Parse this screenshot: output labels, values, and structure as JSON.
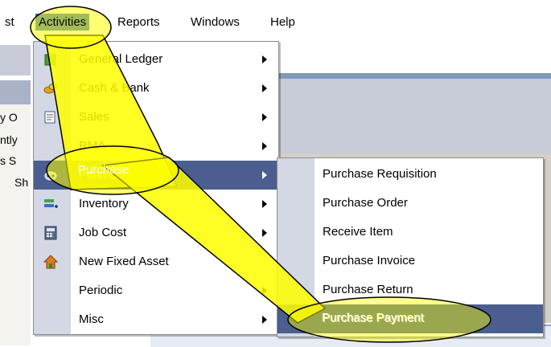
{
  "menubar": {
    "partial_left": "st",
    "activities": "Activities",
    "reports": "Reports",
    "windows": "Windows",
    "help": "Help"
  },
  "background_fragments": [
    "y O",
    "ntly",
    "s S",
    "Sh"
  ],
  "activities_menu": {
    "items": [
      {
        "label": "General Ledger",
        "icon": "ledger-book-icon",
        "submenu": true
      },
      {
        "label": "Cash & Bank",
        "icon": "coins-icon",
        "submenu": true
      },
      {
        "label": "Sales",
        "icon": "sales-invoice-icon",
        "submenu": true
      },
      {
        "label": "RMA",
        "icon": "",
        "submenu": true
      },
      {
        "label": "Purchase",
        "icon": "purchase-cart-icon",
        "submenu": true,
        "highlighted": true
      },
      {
        "label": "Inventory",
        "icon": "inventory-boxes-icon",
        "submenu": true
      },
      {
        "label": "Job Cost",
        "icon": "job-cost-calculator-icon",
        "submenu": true
      },
      {
        "label": "New Fixed Asset",
        "icon": "house-icon",
        "submenu": false
      },
      {
        "label": "Periodic",
        "icon": "",
        "submenu": true
      },
      {
        "label": "Misc",
        "icon": "",
        "submenu": true
      }
    ]
  },
  "purchase_submenu": {
    "items": [
      {
        "label": "Purchase Requisition"
      },
      {
        "label": "Purchase Order"
      },
      {
        "label": "Receive Item"
      },
      {
        "label": "Purchase Invoice"
      },
      {
        "label": "Purchase Return"
      },
      {
        "label": "Purchase Payment",
        "highlighted": true
      }
    ]
  },
  "annotation": {
    "color": "#ffff00",
    "outline_color": "#000000",
    "overlay_text": "Purchase"
  },
  "colors": {
    "highlight_main": "#4a5f8f",
    "highlight_sub": "#4a5f8f",
    "menubar_active": "#316ac5",
    "gutter": "#d4d8e4"
  }
}
